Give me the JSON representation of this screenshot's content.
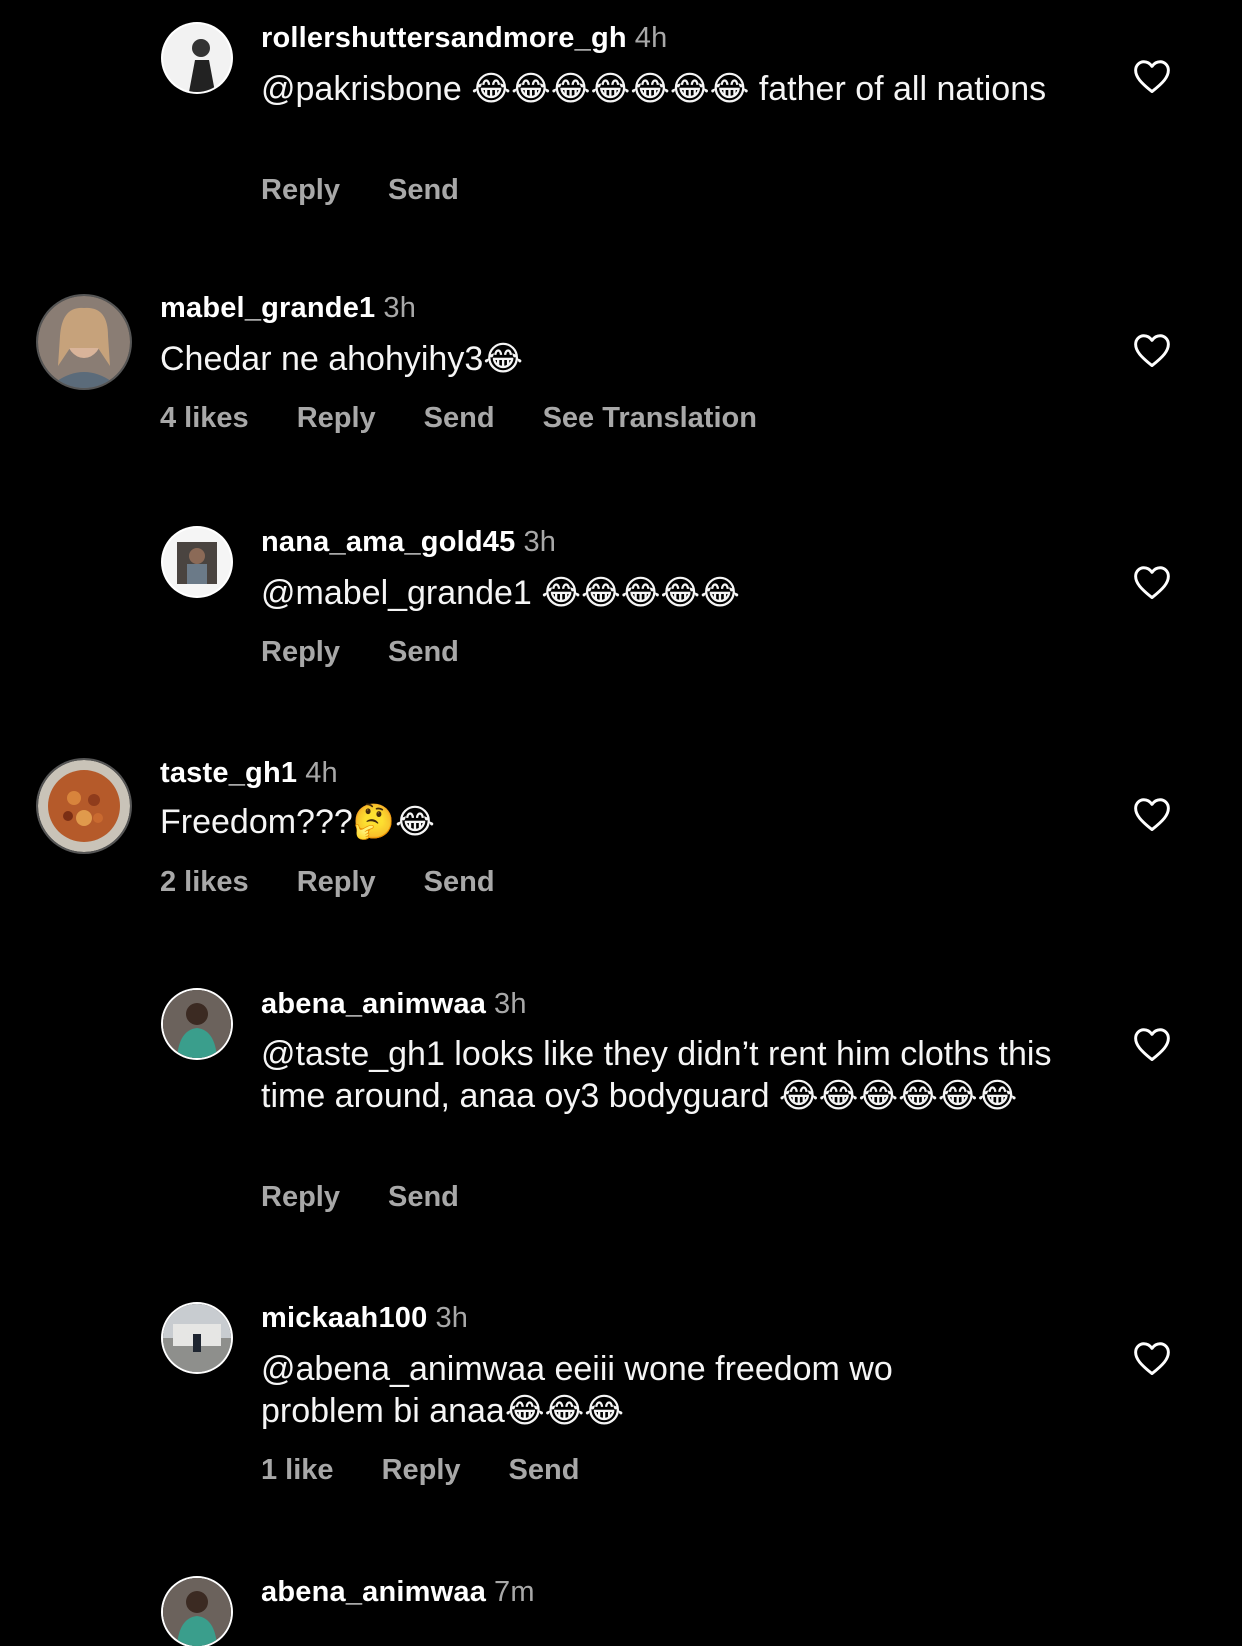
{
  "comments": [
    {
      "username": "rollershuttersandmore_gh",
      "time": "4h",
      "text": "@pakrisbone 😂😂😂😂😂😂😂 father of all nations",
      "actions": {
        "reply": "Reply",
        "send": "Send"
      }
    },
    {
      "username": "mabel_grande1",
      "time": "3h",
      "text": "Chedar ne ahohyihy3😂",
      "actions": {
        "likes": "4 likes",
        "reply": "Reply",
        "send": "Send",
        "translate": "See Translation"
      }
    },
    {
      "username": "nana_ama_gold45",
      "time": "3h",
      "text": "@mabel_grande1 😂😂😂😂😂",
      "actions": {
        "reply": "Reply",
        "send": "Send"
      }
    },
    {
      "username": "taste_gh1",
      "time": "4h",
      "text": "Freedom???🤔😂",
      "actions": {
        "likes": "2 likes",
        "reply": "Reply",
        "send": "Send"
      }
    },
    {
      "username": "abena_animwaa",
      "time": "3h",
      "text": "@taste_gh1 looks like they didn’t rent him cloths this time around, anaa oy3 bodyguard 😂😂😂😂😂😂",
      "actions": {
        "reply": "Reply",
        "send": "Send"
      }
    },
    {
      "username": "mickaah100",
      "time": "3h",
      "text": "@abena_animwaa eeiii wone freedom wo problem bi anaa😂😂😂",
      "actions": {
        "likes": "1 like",
        "reply": "Reply",
        "send": "Send"
      }
    },
    {
      "username": "abena_animwaa",
      "time": "7m"
    }
  ],
  "icons": {
    "like": "heart-outline-icon"
  },
  "colors": {
    "background": "#000000",
    "text": "#ffffff",
    "secondary": "#a8a8a8"
  }
}
